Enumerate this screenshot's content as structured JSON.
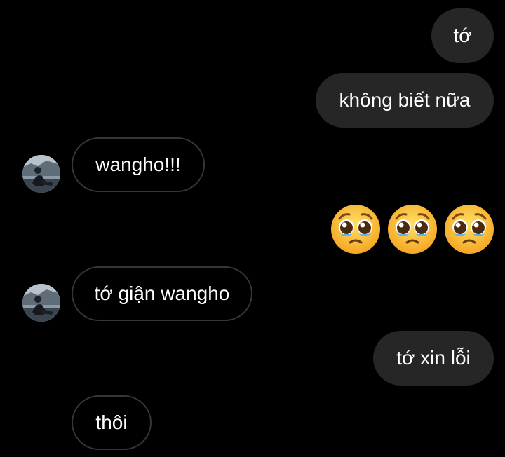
{
  "conversation": {
    "messages": [
      {
        "side": "outgoing",
        "text": "tớ"
      },
      {
        "side": "outgoing",
        "text": "không biết nữa"
      },
      {
        "side": "incoming",
        "text": "wangho!!!"
      },
      {
        "side": "outgoing",
        "emoji": [
          "pleading-face",
          "pleading-face",
          "pleading-face"
        ]
      },
      {
        "side": "incoming",
        "text": "tớ giận wangho"
      },
      {
        "side": "outgoing",
        "text": "tớ xin lỗi"
      },
      {
        "side": "incoming",
        "text": "thôi"
      }
    ]
  },
  "colors": {
    "background": "#000000",
    "outgoing_bubble": "#262626",
    "incoming_border": "#363636",
    "text": "#ffffff"
  }
}
